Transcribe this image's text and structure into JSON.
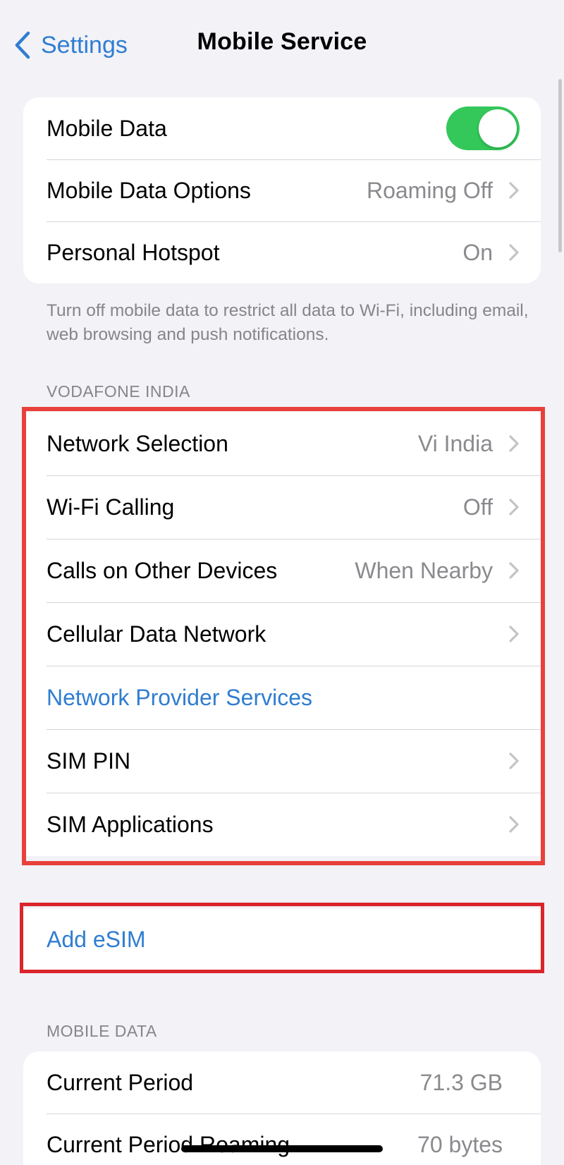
{
  "nav": {
    "back_label": "Settings",
    "title": "Mobile Service"
  },
  "group_main": {
    "rows": [
      {
        "label": "Mobile Data",
        "toggle_on": true
      },
      {
        "label": "Mobile Data Options",
        "value": "Roaming Off"
      },
      {
        "label": "Personal Hotspot",
        "value": "On"
      }
    ],
    "footer": "Turn off mobile data to restrict all data to Wi-Fi, including email, web browsing and push notifications."
  },
  "carrier": {
    "header": "VODAFONE INDIA",
    "rows": [
      {
        "label": "Network Selection",
        "value": "Vi India"
      },
      {
        "label": "Wi-Fi Calling",
        "value": "Off"
      },
      {
        "label": "Calls on Other Devices",
        "value": "When Nearby"
      },
      {
        "label": "Cellular Data Network",
        "value": ""
      },
      {
        "label": "Network Provider Services"
      },
      {
        "label": "SIM PIN",
        "value": ""
      },
      {
        "label": "SIM Applications",
        "value": ""
      }
    ]
  },
  "esim": {
    "label": "Add eSIM"
  },
  "usage": {
    "header": "MOBILE DATA",
    "rows": [
      {
        "label": "Current Period",
        "value": "71.3 GB"
      },
      {
        "label": "Current Period Roaming",
        "value": "70 bytes"
      }
    ]
  },
  "colors": {
    "accent": "#2f7dd1",
    "toggle_on": "#34c759",
    "highlight": "#e8403b"
  }
}
